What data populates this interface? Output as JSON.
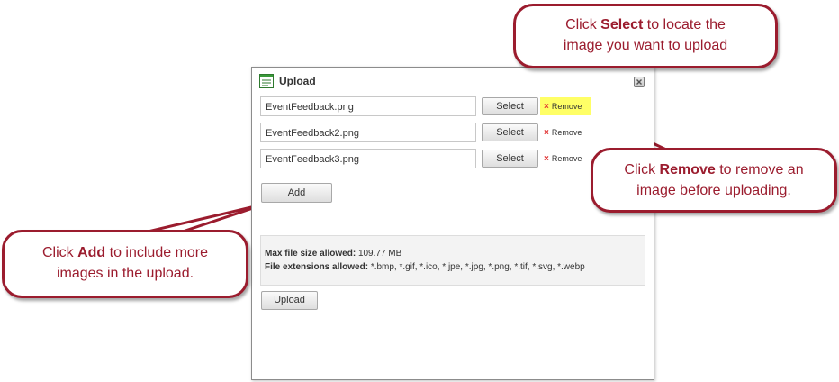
{
  "dialog": {
    "title": "Upload",
    "files": [
      {
        "name": "EventFeedback.png",
        "select_label": "Select",
        "remove_label": "Remove"
      },
      {
        "name": "EventFeedback2.png",
        "select_label": "Select",
        "remove_label": "Remove"
      },
      {
        "name": "EventFeedback3.png",
        "select_label": "Select",
        "remove_label": "Remove"
      }
    ],
    "add_label": "Add",
    "info": {
      "max_size_label": "Max file size allowed:",
      "max_size_value": "109.77 MB",
      "extensions_label": "File extensions allowed:",
      "extensions_value": "*.bmp, *.gif, *.ico, *.jpe, *.jpg, *.png, *.tif, *.svg, *.webp"
    },
    "upload_label": "Upload"
  },
  "callouts": {
    "select": {
      "pre": "Click ",
      "bold": "Select",
      "post": " to locate the",
      "line2": "image you want to upload"
    },
    "remove": {
      "pre": "Click ",
      "bold": "Remove",
      "post": " to remove an",
      "line2": "image before uploading."
    },
    "add": {
      "pre": "Click ",
      "bold": "Add",
      "post": " to include more",
      "line2": "images in the upload."
    }
  },
  "colors": {
    "callout_border": "#9b1c2e",
    "highlight": "#ffff66",
    "remove_x": "#e03030"
  },
  "icons": {
    "title": "window-list-icon",
    "close": "close-icon",
    "remove": "x-icon"
  }
}
